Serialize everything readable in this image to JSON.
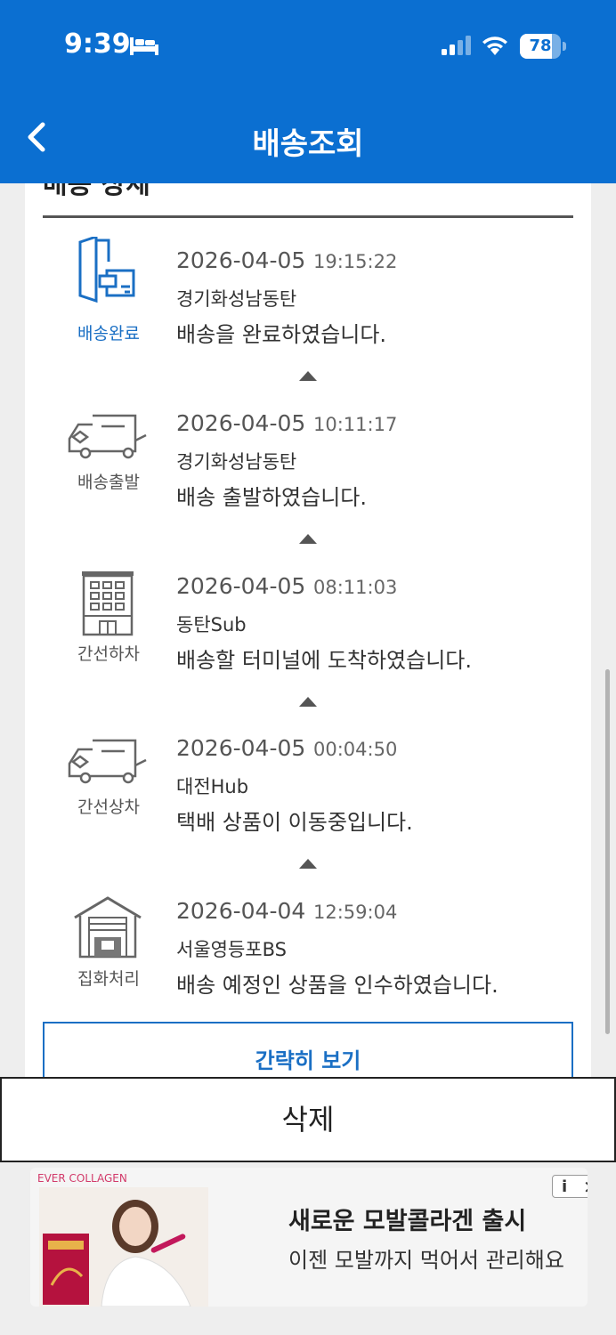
{
  "status_bar": {
    "time": "9:39",
    "battery": "78",
    "battery_level_percent": 78
  },
  "header": {
    "title": "배송조회"
  },
  "section": {
    "title_cut": "배송 상세"
  },
  "timeline": [
    {
      "date": "2026-04-05",
      "time": "19:15:22",
      "location": "경기화성남동탄",
      "message": "배송을 완료하였습니다.",
      "status_label": "배송완료",
      "icon": "delivered-door-box-icon",
      "active": true
    },
    {
      "date": "2026-04-05",
      "time": "10:11:17",
      "location": "경기화성남동탄",
      "message": "배송 출발하였습니다.",
      "status_label": "배송출발",
      "icon": "delivery-truck-icon",
      "active": false
    },
    {
      "date": "2026-04-05",
      "time": "08:11:03",
      "location": "동탄Sub",
      "message": "배송할 터미널에 도착하였습니다.",
      "status_label": "간선하차",
      "icon": "terminal-building-icon",
      "active": false
    },
    {
      "date": "2026-04-05",
      "time": "00:04:50",
      "location": "대전Hub",
      "message": "택배 상품이 이동중입니다.",
      "status_label": "간선상차",
      "icon": "delivery-truck-icon",
      "active": false
    },
    {
      "date": "2026-04-04",
      "time": "12:59:04",
      "location": "서울영등포BS",
      "message": "배송 예정인 상품을 인수하였습니다.",
      "status_label": "집화처리",
      "icon": "warehouse-icon",
      "active": false
    }
  ],
  "buttons": {
    "simple_view": "간략히 보기",
    "delete": "삭제"
  },
  "ad": {
    "brand": "EVER COLLAGEN",
    "headline": "새로운 모발콜라겐 출시",
    "subline": "이젠 모발까지 먹어서 관리해요",
    "info_glyph": "i",
    "close_glyph": "✕"
  },
  "colors": {
    "header_blue": "#0b6fd1",
    "accent_blue": "#1a6fc4"
  }
}
